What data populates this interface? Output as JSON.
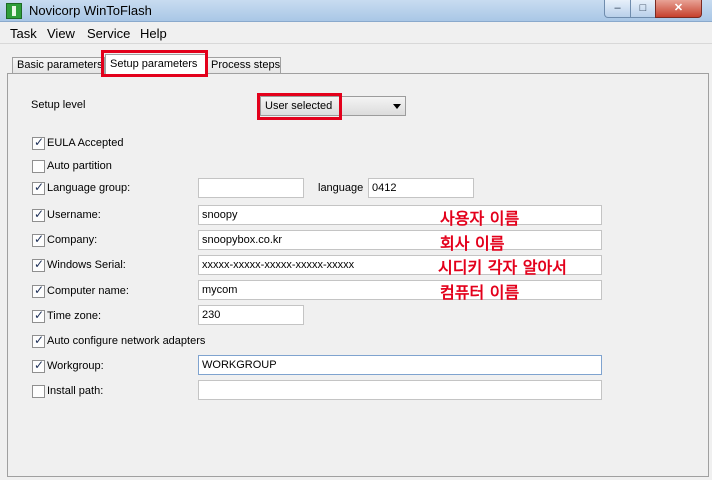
{
  "window": {
    "title": "Novicorp WinToFlash",
    "min_label": "–",
    "max_label": "□",
    "close_label": "✕"
  },
  "menu": {
    "items": [
      "Task",
      "View",
      "Service",
      "Help"
    ]
  },
  "tabs": [
    "Basic parameters",
    "Setup parameters",
    "Process steps"
  ],
  "setup_level": {
    "label": "Setup level",
    "value": "User selected"
  },
  "options": {
    "eula": {
      "label": "EULA Accepted",
      "checked": true
    },
    "auto_partition": {
      "label": "Auto partition",
      "checked": false
    },
    "language_group": {
      "label": "Language group:",
      "checked": true,
      "value": ""
    },
    "language": {
      "label": "language",
      "value": "0412"
    },
    "username": {
      "label": "Username:",
      "checked": true,
      "value": "snoopy"
    },
    "company": {
      "label": "Company:",
      "checked": true,
      "value": "snoopybox.co.kr"
    },
    "serial": {
      "label": "Windows Serial:",
      "checked": true,
      "value": "xxxxx-xxxxx-xxxxx-xxxxx-xxxxx"
    },
    "computer_name": {
      "label": "Computer name:",
      "checked": true,
      "value": "mycom"
    },
    "time_zone": {
      "label": "Time zone:",
      "checked": true,
      "value": "230"
    },
    "auto_network": {
      "label": "Auto configure network adapters",
      "checked": true
    },
    "workgroup": {
      "label": "Workgroup:",
      "checked": true,
      "value": "WORKGROUP"
    },
    "install_path": {
      "label": "Install path:",
      "checked": false,
      "value": ""
    }
  },
  "annotations": {
    "username": "사용자 이름",
    "company": "회사 이름",
    "serial": "시디키 각자 알아서",
    "computer_name": "컴퓨터 이름"
  },
  "colors": {
    "highlight": "#e3001b"
  }
}
